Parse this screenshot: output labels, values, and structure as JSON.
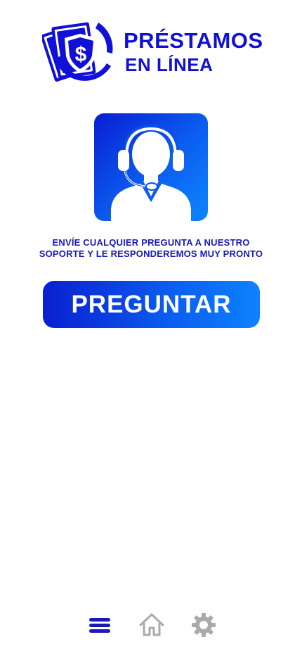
{
  "brand": {
    "line1": "PRÉSTAMOS",
    "line2": "EN LÍNEA",
    "primary_color": "#1010d6",
    "logo_icon": "money-bills-dollar-icon"
  },
  "support": {
    "icon": "customer-support-headset-icon",
    "message_line1": "ENVÍE CUALQUIER PREGUNTA A NUESTRO",
    "message_line2": "SOPORTE Y LE RESPONDEREMOS MUY PRONTO",
    "text_color": "#1a1ab8"
  },
  "action": {
    "button_label": "PREGUNTAR",
    "gradient_start": "#0a1fd0",
    "gradient_end": "#0d82ff"
  },
  "bottom_nav": {
    "items": [
      {
        "id": "menu",
        "icon": "menu-icon",
        "active": true,
        "color": "#1a1ab8"
      },
      {
        "id": "home",
        "icon": "home-icon",
        "active": false,
        "color": "#aaaaaa"
      },
      {
        "id": "settings",
        "icon": "gear-icon",
        "active": false,
        "color": "#aaaaaa"
      }
    ]
  }
}
